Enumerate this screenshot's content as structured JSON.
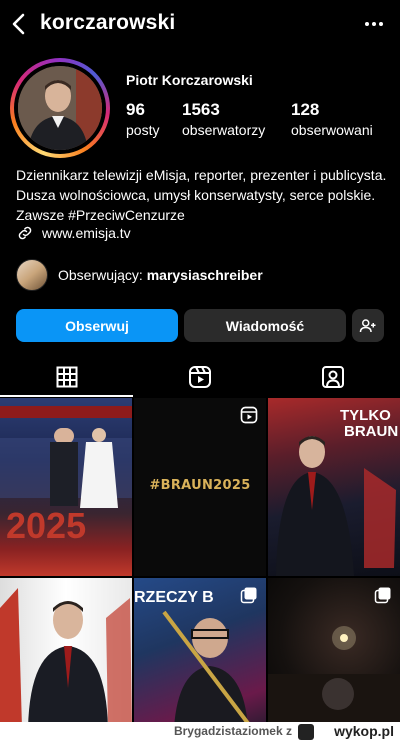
{
  "header": {
    "username": "korczarowski",
    "back_icon": "chevron-left-icon",
    "more_icon": "more-horizontal-icon"
  },
  "profile": {
    "full_name": "Piotr Korczarowski",
    "stats": [
      {
        "value": "96",
        "label": "posty"
      },
      {
        "value": "1563",
        "label": "obserwatorzy"
      },
      {
        "value": "128",
        "label": "obserwowani"
      }
    ],
    "bio": "Dziennikarz telewizji eMisja, reporter, prezenter i publicysta. Dusza wolnościowca, umysł konserwatysty, serce polskie. Zawsze #PrzeciwCenzurze",
    "link": "www.emisja.tv",
    "followed_by_prefix": "Obserwujący: ",
    "followed_by_user": "marysiaschreiber"
  },
  "actions": {
    "follow_label": "Obserwuj",
    "message_label": "Wiadomość",
    "add_person_icon": "add-person-icon",
    "follow_color": "#0a95f6"
  },
  "tabs": [
    {
      "name": "grid",
      "icon": "grid-icon",
      "active": true
    },
    {
      "name": "reels",
      "icon": "reels-icon",
      "active": false
    },
    {
      "name": "tagged",
      "icon": "tagged-icon",
      "active": false
    }
  ],
  "posts": {
    "post2_text": "#BRAUN2025"
  },
  "footer": {
    "username": "Brygadzistaziomek",
    "suffix": "z",
    "site": "wykop.pl"
  }
}
